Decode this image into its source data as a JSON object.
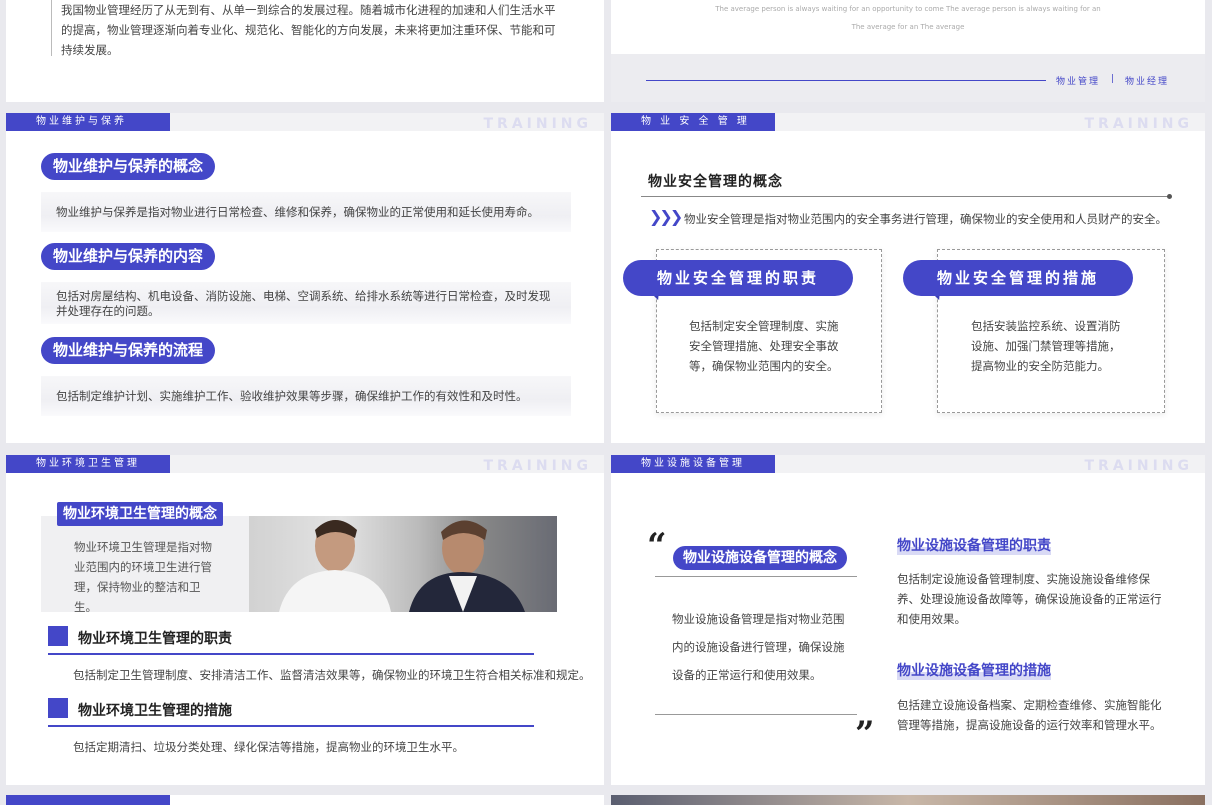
{
  "s1": {
    "intro": "我国物业管理经历了从无到有、从单一到综合的发展过程。随着城市化进程的加速和人们生活水平的提高，物业管理逐渐向着专业化、规范化、智能化的方向发展，未来将更加注重环保、节能和可持续发展。"
  },
  "s2": {
    "eng_line1": "The average person is always waiting for an opportunity to come The average person is always waiting for an",
    "eng_line2": "The average for an The average",
    "tag1": "物业管理",
    "sep": "|",
    "tag2": "物业经理"
  },
  "s3": {
    "header": "物业维护与保养",
    "watermark": "TRAINING",
    "items": [
      {
        "title": "物业维护与保养的概念",
        "text": "物业维护与保养是指对物业进行日常检查、维修和保养，确保物业的正常使用和延长使用寿命。"
      },
      {
        "title": "物业维护与保养的内容",
        "text": "包括对房屋结构、机电设备、消防设施、电梯、空调系统、给排水系统等进行日常检查，及时发现并处理存在的问题。"
      },
      {
        "title": "物业维护与保养的流程",
        "text": "包括制定维护计划、实施维护工作、验收维护效果等步骤，确保维护工作的有效性和及时性。"
      }
    ]
  },
  "s4": {
    "header": "物 业 安 全 管 理",
    "watermark": "TRAINING",
    "title": "物业安全管理的概念",
    "concept": "物业安全管理是指对物业范围内的安全事务进行管理，确保物业的安全使用和人员财产的安全。",
    "card1_title": "物业安全管理的职责",
    "card1_text": "包括制定安全管理制度、实施安全管理措施、处理安全事故等，确保物业范围内的安全。",
    "card2_title": "物业安全管理的措施",
    "card2_text": "包括安装监控系统、设置消防设施、加强门禁管理等措施，提高物业的安全防范能力。"
  },
  "s5": {
    "header": "物业环境卫生管理",
    "watermark": "TRAINING",
    "concept_title": "物业环境卫生管理的概念",
    "concept_text": "物业环境卫生管理是指对物业范围内的环境卫生进行管理，保持物业的整洁和卫生。",
    "duty_title": "物业环境卫生管理的职责",
    "duty_text": "包括制定卫生管理制度、安排清洁工作、监督清洁效果等，确保物业的环境卫生符合相关标准和规定。",
    "measure_title": "物业环境卫生管理的措施",
    "measure_text": "包括定期清扫、垃圾分类处理、绿化保洁等措施，提高物业的环境卫生水平。"
  },
  "s6": {
    "header": "物业设施设备管理",
    "watermark": "TRAINING",
    "concept_title": "物业设施设备管理的概念",
    "concept_text": "物业设施设备管理是指对物业范围内的设施设备进行管理，确保设施设备的正常运行和使用效果。",
    "duty_title": "物业设施设备管理的职责",
    "duty_text": "包括制定设施设备管理制度、实施设施设备维修保养、处理设施设备故障等，确保设施设备的正常运行和使用效果。",
    "measure_title": "物业设施设备管理的措施",
    "measure_text": "包括建立设施设备档案、定期检查维修、实施智能化管理等措施，提高设施设备的运行效率和管理水平。"
  },
  "colors": {
    "accent": "#4447c8",
    "bg": "#e9e9ee"
  }
}
